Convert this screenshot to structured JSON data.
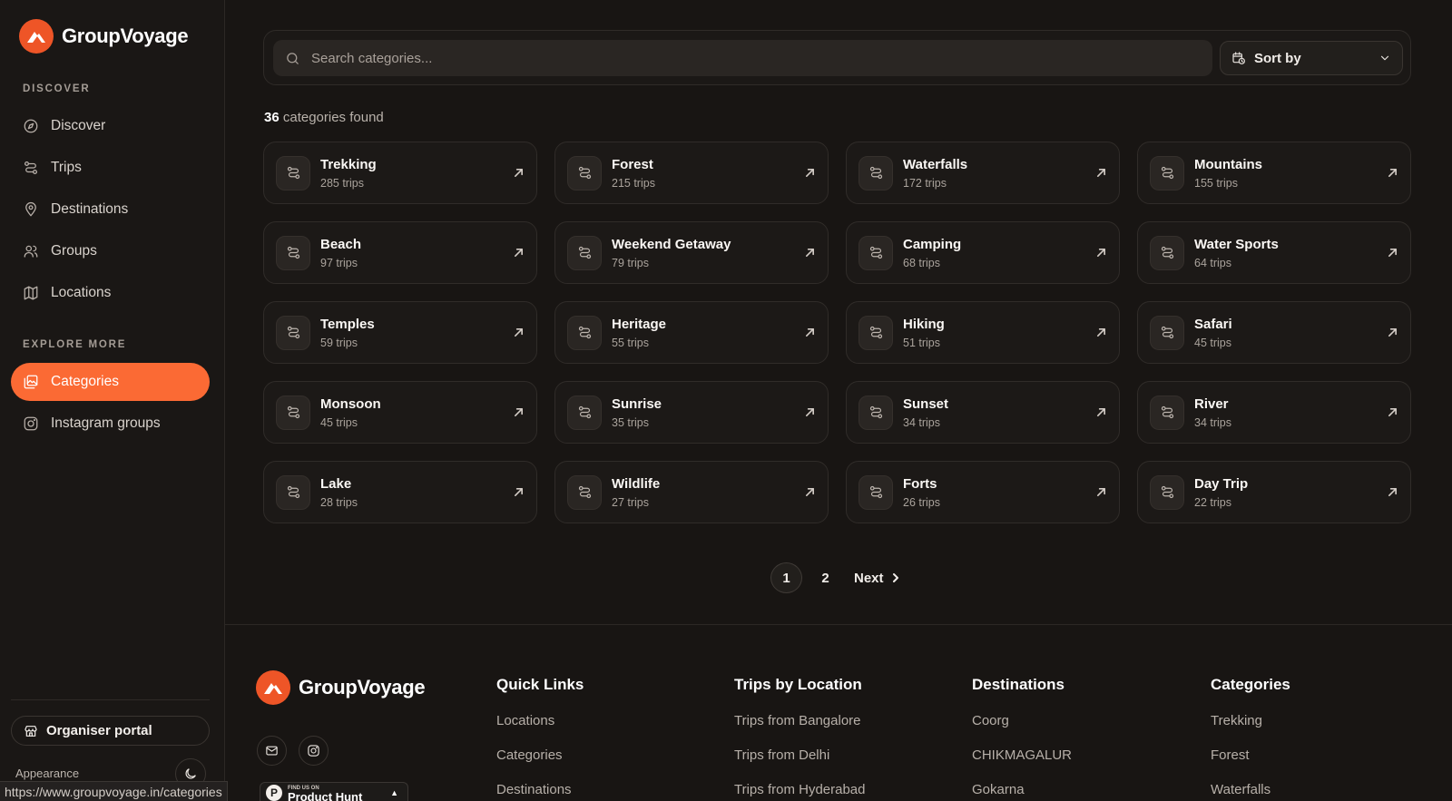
{
  "app": {
    "name": "GroupVoyage"
  },
  "sidebar": {
    "discover_label": "DISCOVER",
    "explore_label": "EXPLORE MORE",
    "items": [
      {
        "label": "Discover",
        "icon": "compass-icon"
      },
      {
        "label": "Trips",
        "icon": "route-icon"
      },
      {
        "label": "Destinations",
        "icon": "map-pin-icon"
      },
      {
        "label": "Groups",
        "icon": "users-icon"
      },
      {
        "label": "Locations",
        "icon": "map-icon"
      }
    ],
    "explore_items": [
      {
        "label": "Categories",
        "icon": "image-stack-icon",
        "active": true
      },
      {
        "label": "Instagram groups",
        "icon": "instagram-icon"
      }
    ],
    "organiser_label": "Organiser portal",
    "appearance_label": "Appearance",
    "accent_color": "#fb6a34"
  },
  "search": {
    "placeholder": "Search categories...",
    "sort_label": "Sort by"
  },
  "results": {
    "count": "36",
    "count_suffix": " categories found"
  },
  "categories": [
    {
      "name": "Trekking",
      "trips": "285 trips"
    },
    {
      "name": "Forest",
      "trips": "215 trips"
    },
    {
      "name": "Waterfalls",
      "trips": "172 trips"
    },
    {
      "name": "Mountains",
      "trips": "155 trips"
    },
    {
      "name": "Beach",
      "trips": "97 trips"
    },
    {
      "name": "Weekend Getaway",
      "trips": "79 trips"
    },
    {
      "name": "Camping",
      "trips": "68 trips"
    },
    {
      "name": "Water Sports",
      "trips": "64 trips"
    },
    {
      "name": "Temples",
      "trips": "59 trips"
    },
    {
      "name": "Heritage",
      "trips": "55 trips"
    },
    {
      "name": "Hiking",
      "trips": "51 trips"
    },
    {
      "name": "Safari",
      "trips": "45 trips"
    },
    {
      "name": "Monsoon",
      "trips": "45 trips"
    },
    {
      "name": "Sunrise",
      "trips": "35 trips"
    },
    {
      "name": "Sunset",
      "trips": "34 trips"
    },
    {
      "name": "River",
      "trips": "34 trips"
    },
    {
      "name": "Lake",
      "trips": "28 trips"
    },
    {
      "name": "Wildlife",
      "trips": "27 trips"
    },
    {
      "name": "Forts",
      "trips": "26 trips"
    },
    {
      "name": "Day Trip",
      "trips": "22 trips"
    }
  ],
  "pagination": {
    "pages": [
      "1",
      "2"
    ],
    "current": "1",
    "next_label": "Next"
  },
  "footer": {
    "brand": "GroupVoyage",
    "columns": [
      {
        "title": "Quick Links",
        "links": [
          "Locations",
          "Categories",
          "Destinations"
        ]
      },
      {
        "title": "Trips by Location",
        "links": [
          "Trips from Bangalore",
          "Trips from Delhi",
          "Trips from Hyderabad"
        ]
      },
      {
        "title": "Destinations",
        "links": [
          "Coorg",
          "CHIKMAGALUR",
          "Gokarna"
        ]
      },
      {
        "title": "Categories",
        "links": [
          "Trekking",
          "Forest",
          "Waterfalls"
        ]
      }
    ]
  },
  "status_bar": {
    "url": "https://www.groupvoyage.in/categories"
  },
  "product_hunt": {
    "small": "FIND US ON",
    "big": "Product Hunt"
  }
}
